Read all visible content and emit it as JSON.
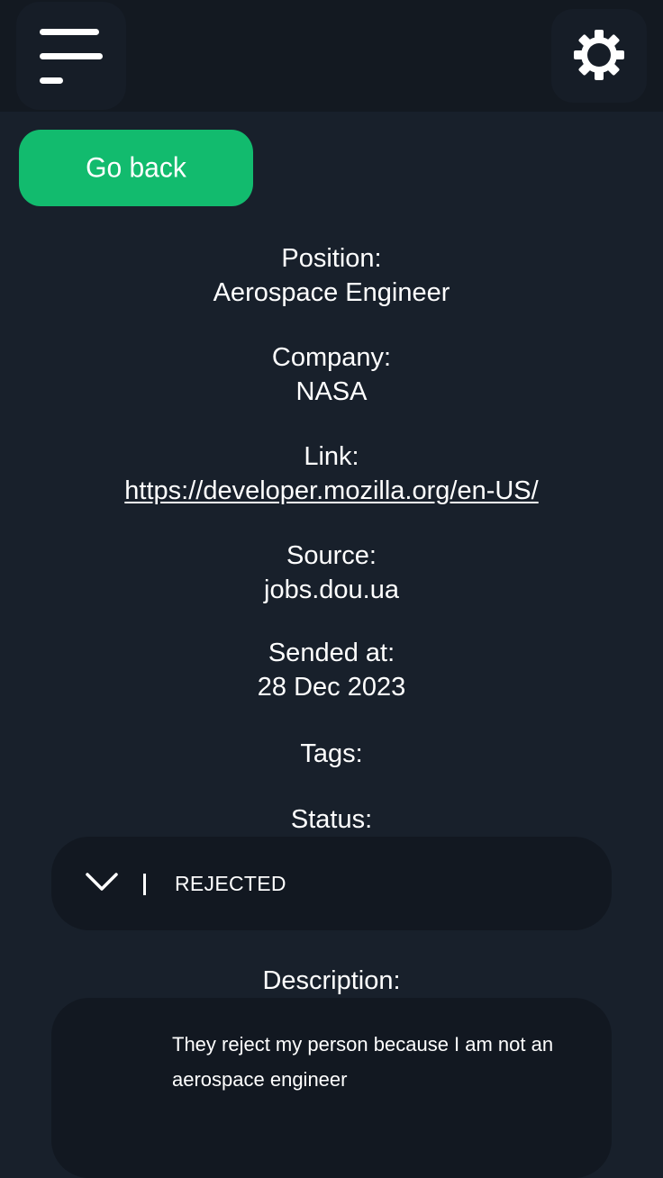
{
  "header": {
    "menu_icon": "menu-icon",
    "settings_icon": "gear-icon"
  },
  "actions": {
    "go_back_label": "Go back"
  },
  "details": {
    "position_label": "Position:",
    "position_value": "Aerospace Engineer",
    "company_label": "Company:",
    "company_value": "NASA",
    "link_label": "Link:",
    "link_value": "https://developer.mozilla.org/en-US/",
    "source_label": "Source:",
    "source_value": "jobs.dou.ua",
    "sended_label": "Sended at:",
    "sended_value": "28 Dec 2023",
    "tags_label": "Tags:",
    "status_label": "Status:"
  },
  "status": {
    "selected": "REJECTED",
    "dropdown_icon": "chevron-down-icon"
  },
  "description": {
    "label": "Description:",
    "text": "They reject my person because I am not an aerospace engineer"
  },
  "colors": {
    "background": "#18202b",
    "topbar": "#131921",
    "accent": "#12bb6e"
  }
}
